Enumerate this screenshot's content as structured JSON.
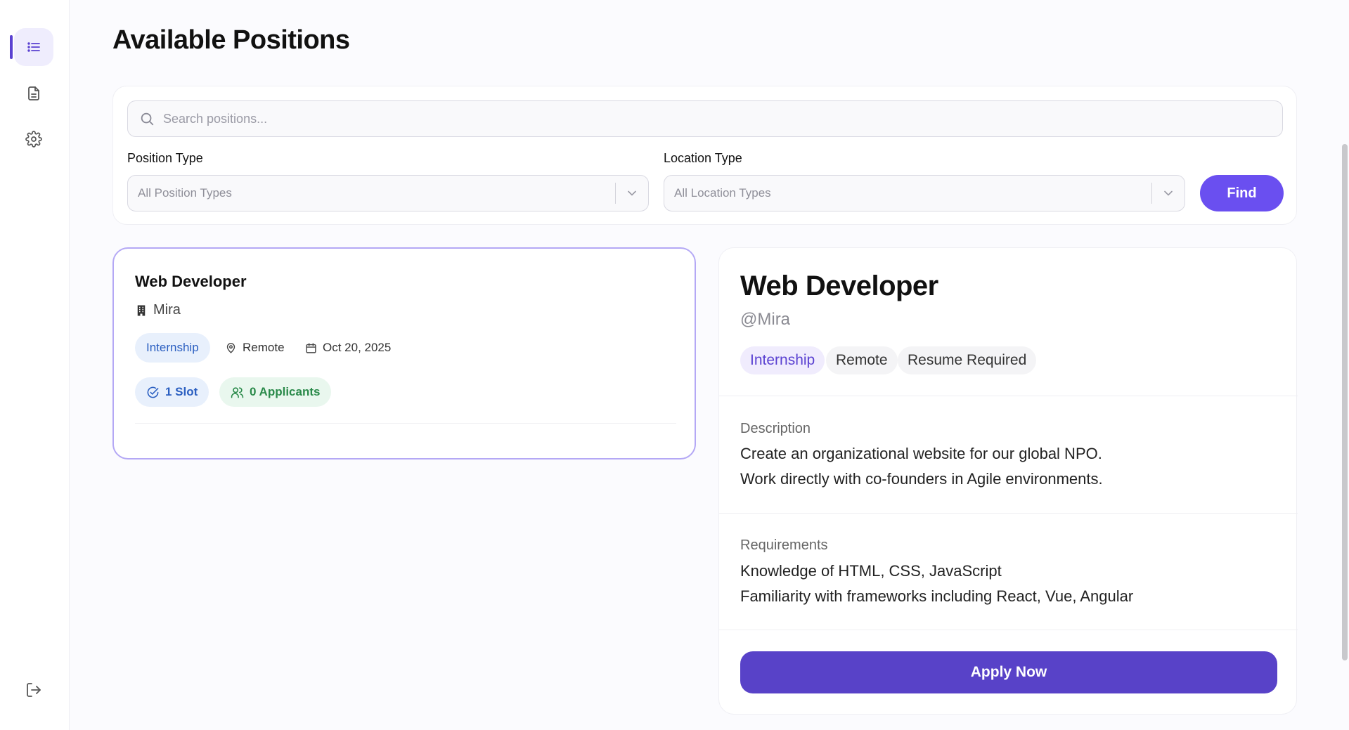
{
  "page": {
    "title": "Available Positions"
  },
  "sidebar": {
    "items": [
      {
        "name": "positions",
        "icon": "list-icon",
        "active": true
      },
      {
        "name": "applications",
        "icon": "document-icon",
        "active": false
      },
      {
        "name": "settings",
        "icon": "gear-icon",
        "active": false
      }
    ],
    "logout_icon": "logout-icon"
  },
  "filters": {
    "search_placeholder": "Search positions...",
    "position_type_label": "Position Type",
    "position_type_value": "All Position Types",
    "location_type_label": "Location Type",
    "location_type_value": "All Location Types",
    "find_label": "Find"
  },
  "job_list": [
    {
      "title": "Web Developer",
      "company": "Mira",
      "type": "Internship",
      "location": "Remote",
      "date": "Oct 20, 2025",
      "slots": "1 Slot",
      "applicants": "0 Applicants"
    }
  ],
  "detail": {
    "title": "Web Developer",
    "handle": "@Mira",
    "tags": [
      "Internship",
      "Remote",
      "Resume Required"
    ],
    "description_label": "Description",
    "description_lines": [
      "Create an organizational website for our global NPO.",
      "Work directly with co-founders in Agile environments."
    ],
    "requirements_label": "Requirements",
    "requirements_lines": [
      "Knowledge of HTML, CSS, JavaScript",
      "Familiarity with frameworks including React, Vue, Angular"
    ],
    "apply_label": "Apply Now"
  },
  "colors": {
    "accent": "#6a4ff0",
    "apply_button": "#5842c8",
    "selected_border": "#b4a8f5"
  }
}
